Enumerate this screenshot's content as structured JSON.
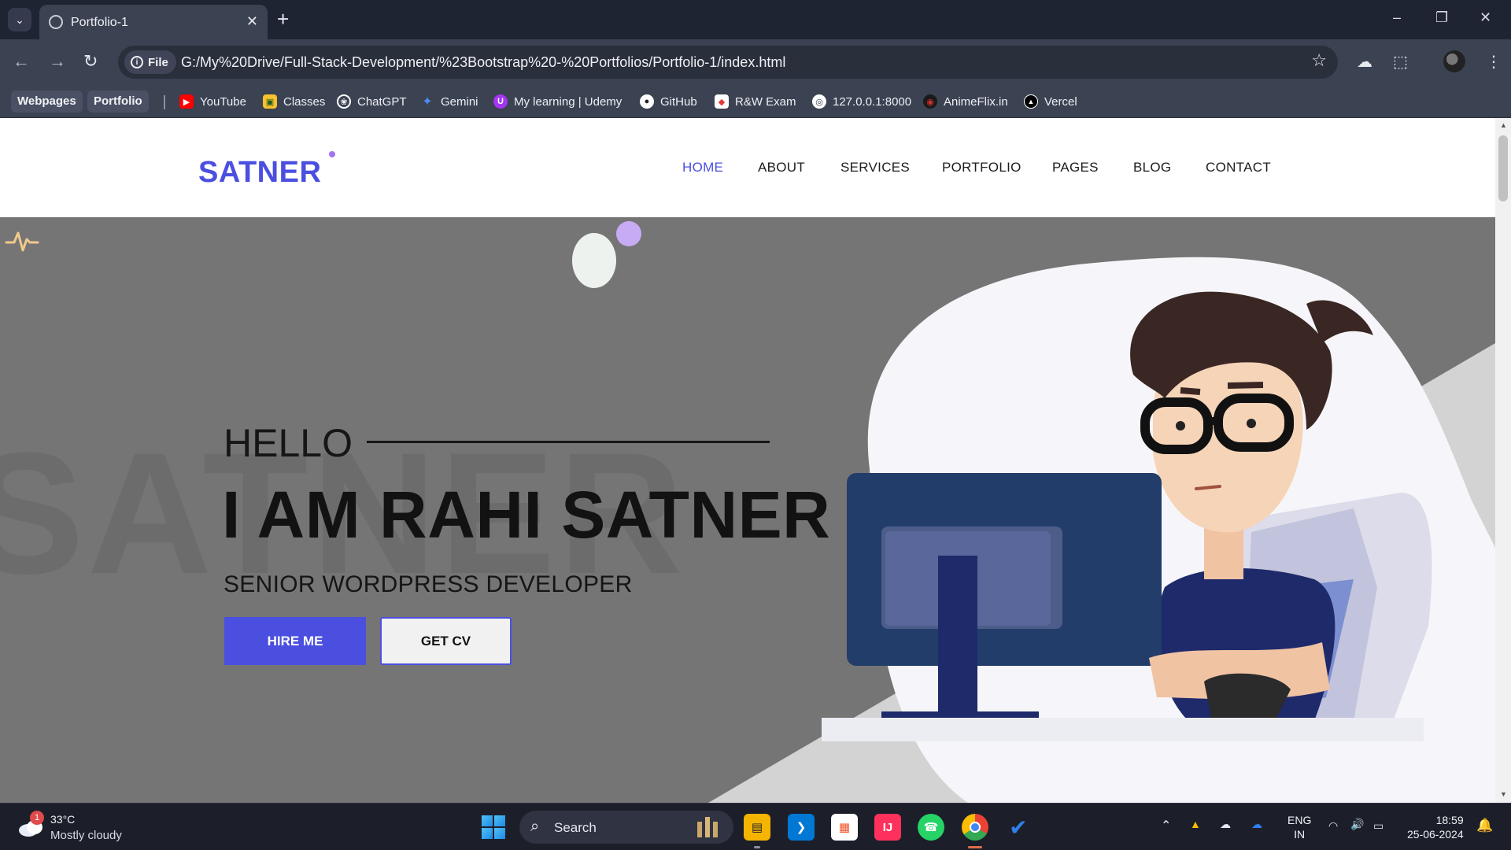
{
  "browser": {
    "tab_title": "Portfolio-1",
    "url_scheme": "File",
    "url": "G:/My%20Drive/Full-Stack-Development/%23Bootstrap%20-%20Portfolios/Portfolio-1/index.html",
    "bookmark_folders": [
      "Webpages",
      "Portfolio"
    ],
    "bookmarks": [
      {
        "label": "YouTube",
        "icon": "youtube-icon",
        "color": "#ff0000"
      },
      {
        "label": "Classes",
        "icon": "classroom-icon",
        "color": "#f9c22e"
      },
      {
        "label": "ChatGPT",
        "icon": "chatgpt-icon",
        "color": "#ffffff"
      },
      {
        "label": "Gemini",
        "icon": "gemini-icon",
        "color": "#4f8cf7"
      },
      {
        "label": "My learning | Udemy",
        "icon": "udemy-icon",
        "color": "#a435f0"
      },
      {
        "label": "GitHub",
        "icon": "github-icon",
        "color": "#ffffff"
      },
      {
        "label": "R&W Exam",
        "icon": "rw-exam-icon",
        "color": "#e53935"
      },
      {
        "label": "127.0.0.1:8000",
        "icon": "globe-icon",
        "color": "#ffffff"
      },
      {
        "label": "AnimeFlix.in",
        "icon": "animeflix-icon",
        "color": "#d32f2f"
      },
      {
        "label": "Vercel",
        "icon": "vercel-icon",
        "color": "#000000"
      }
    ]
  },
  "site": {
    "logo": "SATNER",
    "nav": [
      "HOME",
      "ABOUT",
      "SERVICES",
      "PORTFOLIO",
      "PAGES",
      "BLOG",
      "CONTACT"
    ],
    "active_nav": "HOME",
    "accent_color": "#4b4fe0",
    "hero": {
      "bg_word": "SATNER",
      "greeting": "HELLO",
      "headline": "I AM RAHI SATNER",
      "role": "SENIOR WORDPRESS DEVELOPER",
      "primary_button": "HIRE ME",
      "secondary_button": "GET CV"
    }
  },
  "taskbar": {
    "weather_badge": "1",
    "temperature": "33°C",
    "condition": "Mostly cloudy",
    "search_label": "Search",
    "apps": [
      "file-explorer-icon",
      "vscode-icon",
      "microsoft-store-icon",
      "intellij-icon",
      "whatsapp-icon",
      "chrome-icon",
      "todo-icon"
    ],
    "lang_1": "ENG",
    "lang_2": "IN",
    "time": "18:59",
    "date": "25-06-2024"
  }
}
